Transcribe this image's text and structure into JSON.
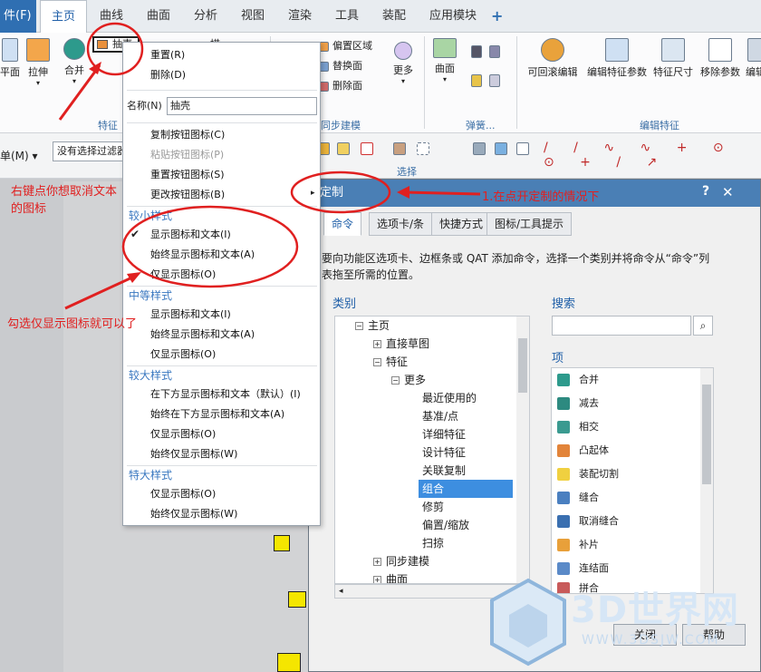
{
  "menubar": {
    "file": "件(F)",
    "tabs": [
      "主页",
      "曲线",
      "曲面",
      "分析",
      "视图",
      "渲染",
      "工具",
      "装配",
      "应用模块"
    ],
    "plus": "+"
  },
  "ribbon": {
    "left_buttons": [
      "平面",
      "拉伸",
      "合并"
    ],
    "shell_label": "抽壳",
    "scan_label": "描",
    "feature_group": "特征",
    "sync": {
      "items": [
        "偏置区域",
        "替换面",
        "删除面"
      ],
      "more": "更多",
      "group": "同步建模"
    },
    "surface": {
      "label": "曲面"
    },
    "spring": {
      "group": "弹簧..."
    },
    "edit": {
      "buttons": [
        "可回滚编辑",
        "编辑特征参数",
        "特征尺寸",
        "移除参数",
        "编辑"
      ],
      "group": "编辑特征"
    }
  },
  "toolbar2": {
    "menu": "单(M)",
    "filter": "没有选择过滤器",
    "select_group": "选择"
  },
  "context_menu": {
    "items": [
      {
        "label": "重置(R)"
      },
      {
        "label": "删除(D)"
      },
      {
        "label": "名称(N)",
        "value": "抽壳"
      },
      {
        "label": "复制按钮图标(C)"
      },
      {
        "label": "粘贴按钮图标(P)",
        "disabled": true
      },
      {
        "label": "重置按钮图标(S)"
      },
      {
        "label": "更改按钮图标(B)"
      }
    ],
    "small": {
      "header": "较小样式",
      "items": [
        "显示图标和文本(I)",
        "始终显示图标和文本(A)",
        "仅显示图标(O)"
      ]
    },
    "medium": {
      "header": "中等样式",
      "items": [
        "显示图标和文本(I)",
        "始终显示图标和文本(A)",
        "仅显示图标(O)"
      ]
    },
    "large": {
      "header": "较大样式",
      "items": [
        "在下方显示图标和文本（默认）(I)",
        "始终在下方显示图标和文本(A)",
        "仅显示图标(O)",
        "始终仅显示图标(W)"
      ]
    },
    "xlarge": {
      "header": "特大样式",
      "items": [
        "仅显示图标(O)",
        "始终仅显示图标(W)"
      ]
    }
  },
  "dialog": {
    "title": "定制",
    "help": "?",
    "close": "✕",
    "tabs": [
      "命令",
      "选项卡/条",
      "快捷方式",
      "图标/工具提示"
    ],
    "instruction": "要向功能区选项卡、边框条或 QAT 添加命令，选择一个类别并将命令从“命令”列表拖至所需的位置。",
    "category_label": "类别",
    "search_label": "搜索",
    "items_label": "项",
    "tree": [
      "主页",
      "直接草图",
      "特征",
      "更多",
      "最近使用的",
      "基准/点",
      "详细特征",
      "设计特征",
      "关联复制",
      "组合",
      "修剪",
      "偏置/缩放",
      "扫掠",
      "同步建模",
      "曲面"
    ],
    "items": [
      "合并",
      "减去",
      "相交",
      "凸起体",
      "装配切割",
      "缝合",
      "取消缝合",
      "补片",
      "连结面",
      "拼合"
    ],
    "footer_btns": [
      "关闭",
      "帮助"
    ]
  },
  "annotations": {
    "a1": "右键点你想取消文本的图标",
    "a2": "勾选仅显示图标就可以了",
    "a3": "1.在点开定制的情况下"
  },
  "watermark": {
    "brand": "3D世界网",
    "url": "WWW.3DSJW.COM"
  }
}
